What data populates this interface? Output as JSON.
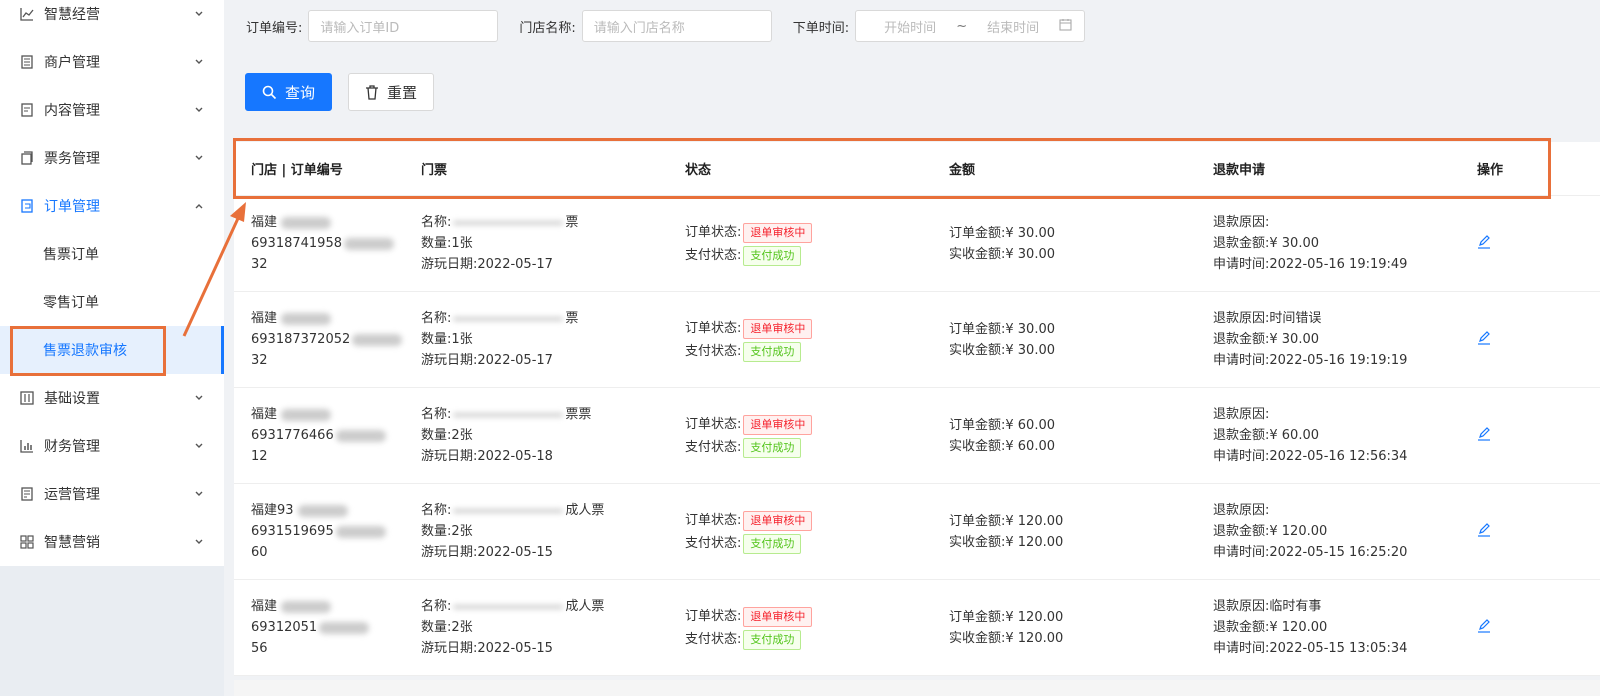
{
  "sidebar": {
    "items": [
      {
        "label": "智慧经营",
        "icon": "chart-line-icon"
      },
      {
        "label": "商户管理",
        "icon": "store-icon"
      },
      {
        "label": "内容管理",
        "icon": "document-icon"
      },
      {
        "label": "票务管理",
        "icon": "ticket-icon"
      },
      {
        "label": "订单管理",
        "icon": "order-icon"
      },
      {
        "label": "基础设置",
        "icon": "settings-icon"
      },
      {
        "label": "财务管理",
        "icon": "bar-chart-icon"
      },
      {
        "label": "运营管理",
        "icon": "operation-icon"
      },
      {
        "label": "智慧营销",
        "icon": "grid-icon"
      }
    ],
    "subitems": [
      "售票订单",
      "零售订单",
      "售票退款审核"
    ]
  },
  "filters": {
    "order_id_label": "订单编号:",
    "order_id_placeholder": "请输入订单ID",
    "store_label": "门店名称:",
    "store_placeholder": "请输入门店名称",
    "time_label": "下单时间:",
    "start_placeholder": "开始时间",
    "tilde": "~",
    "end_placeholder": "结束时间"
  },
  "buttons": {
    "search": "查询",
    "reset": "重置"
  },
  "table": {
    "headers": [
      "门店 | 订单编号",
      "门票",
      "状态",
      "金额",
      "退款申请",
      "操作"
    ],
    "rows": [
      {
        "store": "福建",
        "order_a": "69318741958",
        "order_b": "32",
        "ticket": "票",
        "qty": "数量:1张",
        "date": "游玩日期:2022-05-17",
        "order_status": "订单状态:",
        "order_tag": "退单审核中",
        "pay_status": "支付状态:",
        "pay_tag": "支付成功",
        "order_amount": "订单金额:¥ 30.00",
        "paid_amount": "实收金额:¥ 30.00",
        "reason": "退款原因:",
        "refund": "退款金额:¥ 30.00",
        "apply_time": "申请时间:2022-05-16 19:19:49"
      },
      {
        "store": "福建",
        "order_a": "693187372052",
        "order_b": "32",
        "ticket": "票",
        "qty": "数量:1张",
        "date": "游玩日期:2022-05-17",
        "order_status": "订单状态:",
        "order_tag": "退单审核中",
        "pay_status": "支付状态:",
        "pay_tag": "支付成功",
        "order_amount": "订单金额:¥ 30.00",
        "paid_amount": "实收金额:¥ 30.00",
        "reason": "退款原因:时间错误",
        "refund": "退款金额:¥ 30.00",
        "apply_time": "申请时间:2022-05-16 19:19:19"
      },
      {
        "store": "福建",
        "order_a": "6931776466",
        "order_b": "12",
        "ticket": "票票",
        "qty": "数量:2张",
        "date": "游玩日期:2022-05-18",
        "order_status": "订单状态:",
        "order_tag": "退单审核中",
        "pay_status": "支付状态:",
        "pay_tag": "支付成功",
        "order_amount": "订单金额:¥ 60.00",
        "paid_amount": "实收金额:¥ 60.00",
        "reason": "退款原因:",
        "refund": "退款金额:¥ 60.00",
        "apply_time": "申请时间:2022-05-16 12:56:34"
      },
      {
        "store": "福建93",
        "order_a": "6931519695",
        "order_b": "60",
        "ticket": "成人票",
        "qty": "数量:2张",
        "date": "游玩日期:2022-05-15",
        "order_status": "订单状态:",
        "order_tag": "退单审核中",
        "pay_status": "支付状态:",
        "pay_tag": "支付成功",
        "order_amount": "订单金额:¥ 120.00",
        "paid_amount": "实收金额:¥ 120.00",
        "reason": "退款原因:",
        "refund": "退款金额:¥ 120.00",
        "apply_time": "申请时间:2022-05-15 16:25:20"
      },
      {
        "store": "福建",
        "order_a": "69312051",
        "order_b": "56",
        "ticket": "成人票",
        "qty": "数量:2张",
        "date": "游玩日期:2022-05-15",
        "order_status": "订单状态:",
        "order_tag": "退单审核中",
        "pay_status": "支付状态:",
        "pay_tag": "支付成功",
        "order_amount": "订单金额:¥ 120.00",
        "paid_amount": "实收金额:¥ 120.00",
        "reason": "退款原因:临时有事",
        "refund": "退款金额:¥ 120.00",
        "apply_time": "申请时间:2022-05-15 13:05:34"
      }
    ],
    "ticket_name_label": "名称:"
  },
  "colors": {
    "primary": "#1677ff",
    "annotation": "#e8703a",
    "tag_red": "#f5222d",
    "tag_green": "#52c41a"
  }
}
